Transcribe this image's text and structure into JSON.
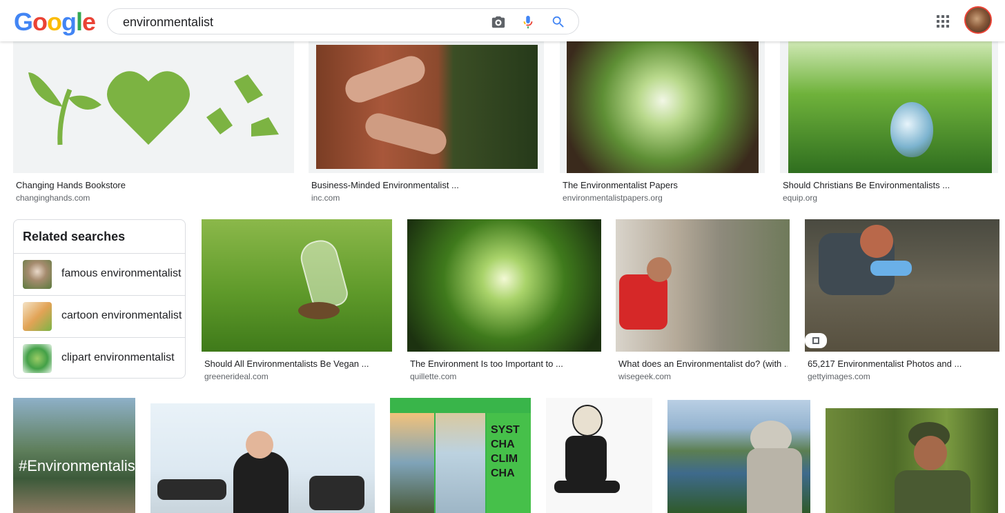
{
  "logo": {
    "letters": [
      "G",
      "o",
      "o",
      "g",
      "l",
      "e"
    ],
    "colors": [
      "#4285f4",
      "#ea4335",
      "#fbbc05",
      "#4285f4",
      "#34a853",
      "#ea4335"
    ]
  },
  "search": {
    "value": "environmentalist",
    "icons": [
      "camera-icon",
      "mic-icon",
      "search-icon"
    ]
  },
  "row1": [
    {
      "title": "Changing Hands Bookstore",
      "source": "changinghands.com"
    },
    {
      "title": "Business-Minded Environmentalist ...",
      "source": "inc.com"
    },
    {
      "title": "The Environmentalist Papers",
      "source": "environmentalistpapers.org"
    },
    {
      "title": "Should Christians Be Environmentalists ...",
      "source": "equip.org"
    }
  ],
  "related": {
    "heading": "Related searches",
    "items": [
      {
        "label": "famous environmentalist"
      },
      {
        "label": "cartoon environmentalist"
      },
      {
        "label": "clipart environmentalist"
      }
    ]
  },
  "row2": [
    {
      "title": "Should All Environmentalists Be Vegan ...",
      "source": "greenerideal.com"
    },
    {
      "title": "The Environment Is too Important to ...",
      "source": "quillette.com"
    },
    {
      "title": "What does an Environmentalist do? (with ...",
      "source": "wisegeek.com"
    },
    {
      "title": "65,217 Environmentalist Photos and ...",
      "source": "gettyimages.com"
    }
  ],
  "row3": {
    "overlay_text": "#Environmentalis",
    "sign_text": "SYST CHA CLIM CHA"
  }
}
